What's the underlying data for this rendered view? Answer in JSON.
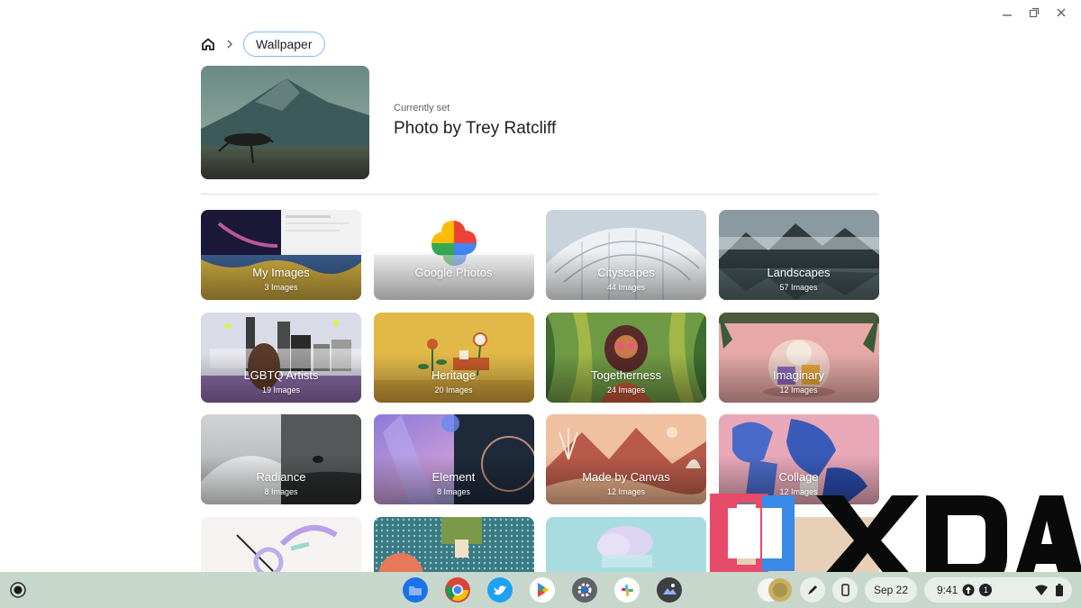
{
  "breadcrumb": {
    "home_icon": "home-icon",
    "current": "Wallpaper"
  },
  "current": {
    "label": "Currently set",
    "title": "Photo by Trey Ratcliff"
  },
  "collections": [
    {
      "title": "My Images",
      "count": "3 Images"
    },
    {
      "title": "Google Photos",
      "count": ""
    },
    {
      "title": "Cityscapes",
      "count": "44 Images"
    },
    {
      "title": "Landscapes",
      "count": "57 Images"
    },
    {
      "title": "LGBTQ Artists",
      "count": "19 Images"
    },
    {
      "title": "Heritage",
      "count": "20 Images"
    },
    {
      "title": "Togetherness",
      "count": "24 Images"
    },
    {
      "title": "Imaginary",
      "count": "12 Images"
    },
    {
      "title": "Radiance",
      "count": "8 Images"
    },
    {
      "title": "Element",
      "count": "8 Images"
    },
    {
      "title": "Made by Canvas",
      "count": "12 Images"
    },
    {
      "title": "Collage",
      "count": "12 Images"
    }
  ],
  "taskbar": {
    "date": "Sep 22",
    "time": "9:41",
    "notification_count": "1",
    "apps": [
      "files-icon",
      "chrome-icon",
      "twitter-icon",
      "play-store-icon",
      "settings-icon",
      "slack-icon",
      "wallpaper-icon"
    ]
  },
  "watermark": {
    "text": "XDA"
  },
  "colors": {
    "accent": "#8ab4f8",
    "taskbar": "#c8d7cc"
  }
}
